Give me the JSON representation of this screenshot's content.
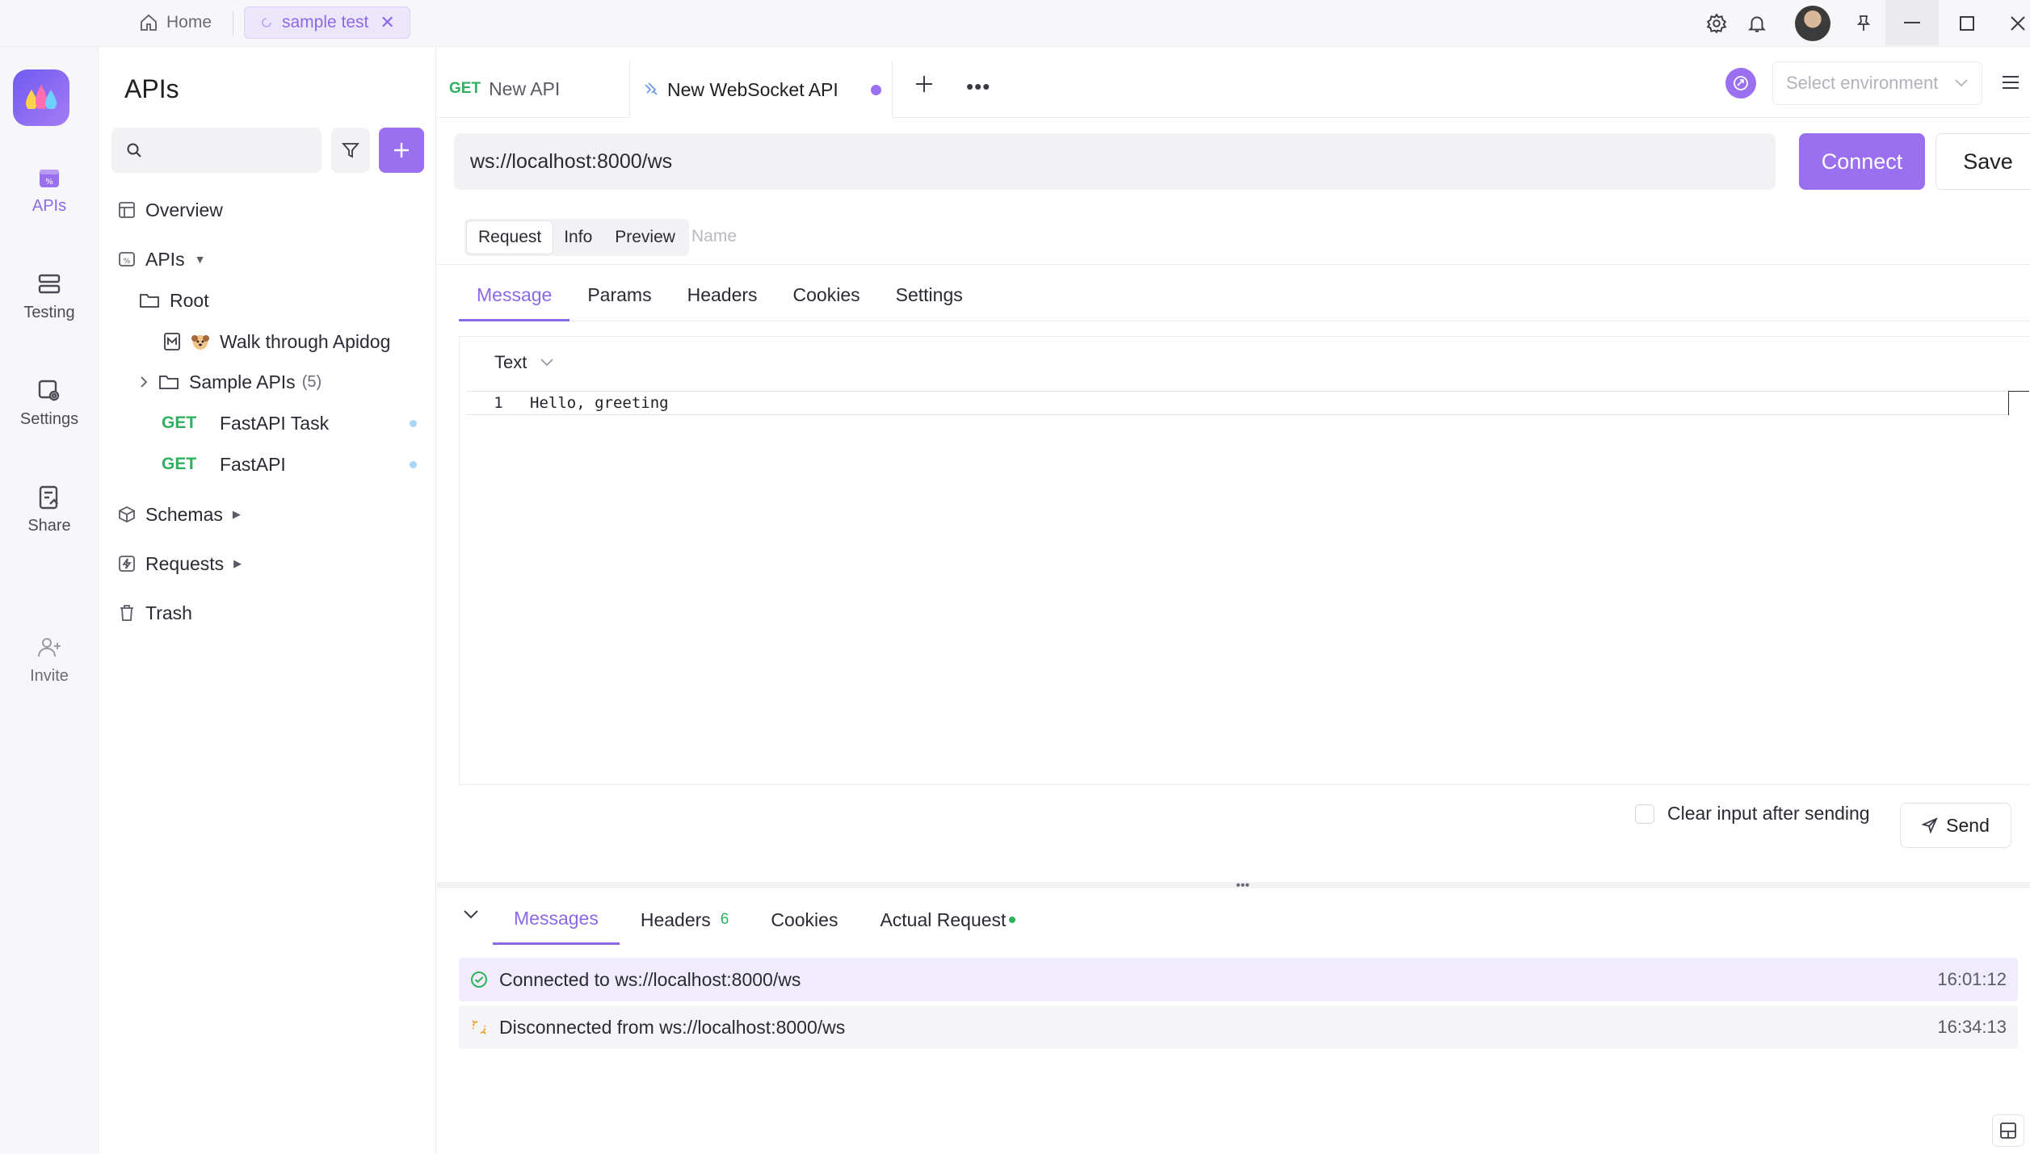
{
  "topbar": {
    "home_label": "Home",
    "project_tab_label": "sample test"
  },
  "rail": {
    "items": [
      {
        "label": "APIs",
        "icon": "apis-icon",
        "active": true
      },
      {
        "label": "Testing",
        "icon": "testing-icon"
      },
      {
        "label": "Settings",
        "icon": "settings-icon"
      },
      {
        "label": "Share",
        "icon": "share-icon"
      },
      {
        "label": "Invite",
        "icon": "invite-icon"
      }
    ]
  },
  "sidebar": {
    "title": "APIs",
    "search_placeholder": "",
    "overview": "Overview",
    "apis_label": "APIs",
    "root": "Root",
    "walk": "Walk through Apidog",
    "sample_apis": "Sample APIs",
    "sample_count": "(5)",
    "endpoints": [
      {
        "method": "GET",
        "name": "FastAPI Task"
      },
      {
        "method": "GET",
        "name": "FastAPI"
      }
    ],
    "schemas": "Schemas",
    "requests": "Requests",
    "trash": "Trash"
  },
  "tabs": {
    "tab1_method": "GET",
    "tab1_name": "New API",
    "tab2_name": "New WebSocket API",
    "env_placeholder": "Select environment"
  },
  "request": {
    "url": "ws://localhost:8000/ws",
    "connect_label": "Connect",
    "save_label": "Save",
    "seg": [
      "Request",
      "Info",
      "Preview"
    ],
    "name_placeholder": "Name",
    "subtabs": [
      "Message",
      "Params",
      "Headers",
      "Cookies",
      "Settings"
    ],
    "body_type": "Text",
    "code_line_no": "1",
    "code_text": "Hello, greeting",
    "clear_label": "Clear input after sending",
    "send_label": "Send"
  },
  "response": {
    "tabs": {
      "messages": "Messages",
      "headers": "Headers",
      "headers_count": "6",
      "cookies": "Cookies",
      "actual_request": "Actual Request"
    },
    "messages": [
      {
        "text": "Connected to ws://localhost:8000/ws",
        "time": "16:01:12",
        "status": "connected"
      },
      {
        "text": "Disconnected from ws://localhost:8000/ws",
        "time": "16:34:13",
        "status": "disconnected"
      }
    ]
  },
  "colors": {
    "accent": "#9a6ff0",
    "get": "#2fb05f"
  }
}
